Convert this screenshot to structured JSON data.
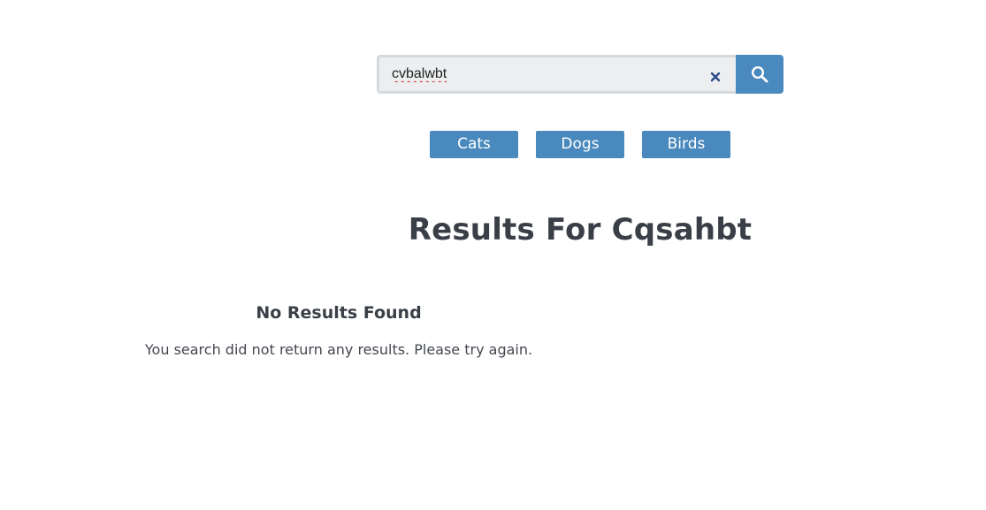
{
  "search": {
    "value": "cvbalwbt",
    "clear_icon": "close-icon",
    "search_icon": "search-icon"
  },
  "categories": [
    {
      "label": "Cats"
    },
    {
      "label": "Dogs"
    },
    {
      "label": "Birds"
    }
  ],
  "results": {
    "title": "Results For Cqsahbt",
    "empty_heading": "No Results Found",
    "empty_message": "You search did not return any results. Please try again."
  },
  "colors": {
    "accent": "#4a89bd",
    "input_bg": "#eceef0",
    "input_border": "#d6d9dd",
    "heading_text": "#3a3f47",
    "clear_icon": "#2d4a8a"
  }
}
